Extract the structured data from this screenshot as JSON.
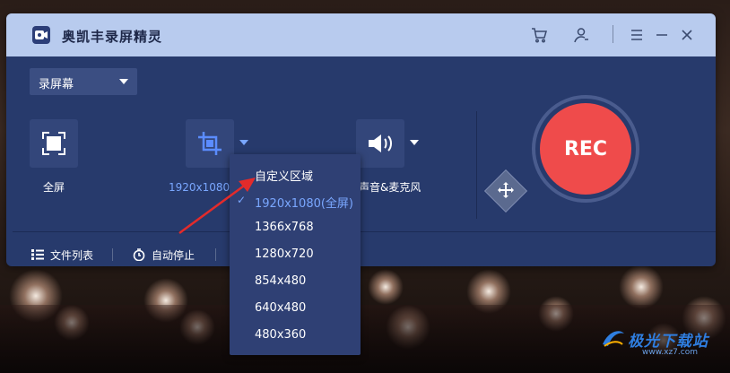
{
  "app": {
    "title": "奥凯丰录屏精灵"
  },
  "mode_select": {
    "value": "录屏幕"
  },
  "controls": {
    "fullscreen_label": "全屏",
    "resolution_label": "1920x1080(全",
    "audio_label": "声音&麦克风",
    "rec_label": "REC"
  },
  "bottom_bar": {
    "file_list": "文件列表",
    "auto_stop": "自动停止"
  },
  "resolution_menu": {
    "items": [
      {
        "label": "自定义区域",
        "selected": false
      },
      {
        "label": "1920x1080(全屏)",
        "selected": true
      },
      {
        "label": "1366x768",
        "selected": false
      },
      {
        "label": "1280x720",
        "selected": false
      },
      {
        "label": "854x480",
        "selected": false
      },
      {
        "label": "640x480",
        "selected": false
      },
      {
        "label": "480x360",
        "selected": false
      }
    ]
  },
  "watermark": {
    "text": "极光下载站",
    "url": "www.xz7.com"
  },
  "colors": {
    "window_bg": "#273a6c",
    "titlebar_bg": "#b8cbee",
    "rec_red": "#ef4b4b",
    "accent_blue": "#7aa7ff",
    "annotation_arrow": "#e32b2b"
  },
  "icons": {
    "titlebar": [
      "cart-icon",
      "user-icon",
      "menu-icon",
      "minimize-icon",
      "close-icon"
    ]
  }
}
